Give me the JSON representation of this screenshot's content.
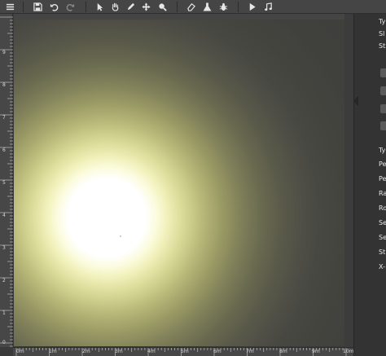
{
  "toolbar": {
    "buttons": [
      {
        "name": "menu-icon"
      },
      {
        "name": "save-icon"
      },
      {
        "name": "undo-icon"
      },
      {
        "name": "redo-icon"
      },
      {
        "name": "select-arrow-icon"
      },
      {
        "name": "hand-icon"
      },
      {
        "name": "pen-icon"
      },
      {
        "name": "move-icon"
      },
      {
        "name": "zoom-icon"
      },
      {
        "name": "eraser-icon"
      },
      {
        "name": "flask-icon"
      },
      {
        "name": "bug-icon"
      },
      {
        "name": "play-icon"
      },
      {
        "name": "music-icon"
      }
    ]
  },
  "ruler_x": [
    "0m",
    "1m",
    "2m",
    "3m",
    "4m",
    "5m",
    "6m",
    "7m",
    "8m",
    "9m",
    "10m"
  ],
  "ruler_y": [
    "9",
    "8",
    "7",
    "6",
    "5",
    "4",
    "3",
    "2",
    "1",
    "0"
  ],
  "panel": {
    "top_labels": [
      "Ty",
      "Sl",
      "St"
    ],
    "props": [
      "Ty",
      "Pe",
      "Pe",
      "Ra",
      "Ro",
      "Se",
      "Se",
      "St",
      "X-"
    ]
  },
  "colors": {
    "background": "#3a3a3a",
    "toolbar": "#454545",
    "ruler": "#474747",
    "light_core": "#ffffff",
    "light_glow": "#f1f1bc"
  }
}
